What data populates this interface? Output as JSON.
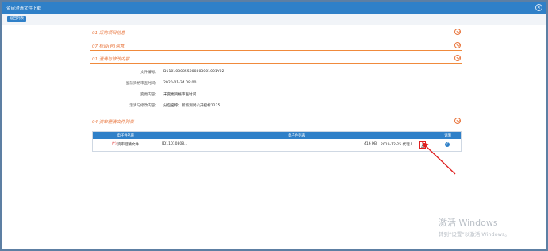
{
  "window": {
    "title": "资审澄清文件下载",
    "close_glyph": "×"
  },
  "toolbar": {
    "back_label": "返回列表"
  },
  "sections": [
    {
      "label": "01 采购项目信息"
    },
    {
      "label": "07 标段(包)信息"
    },
    {
      "label": "01 澄清与修改内容"
    },
    {
      "label": "04 资审澄清文件列表"
    }
  ],
  "clarification": {
    "rows": [
      {
        "key": "文件编号：",
        "value": "D110108085500030300100​1Y02"
      },
      {
        "key": "当前资格审查时间：",
        "value": "2020-01-24 08:00"
      },
      {
        "key": "变更内容：",
        "value": "未变更资格审查时间"
      },
      {
        "key": "澄清与修改内容：",
        "value": "分包名称：新点测试公开招标1225"
      }
    ]
  },
  "file_table": {
    "headers": {
      "name": "电子件名称",
      "list": "电子件列表",
      "action": "说明"
    },
    "row": {
      "name": "资审澄清文件",
      "filename": "[D11010808...",
      "size": "416 KB",
      "date": "2019-12-25 代理人",
      "help_glyph": "?"
    }
  },
  "os_watermark": {
    "line1": "激活 Windows",
    "line2": "转到“设置”以激活 Windows。"
  },
  "colors": {
    "accent_blue": "#2f80c8",
    "section_orange": "#e8743b",
    "annotation_red": "#e02020"
  }
}
